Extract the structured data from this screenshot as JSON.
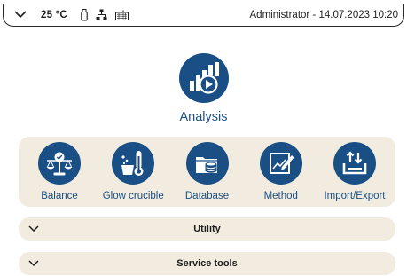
{
  "status_bar": {
    "temperature": "25 °C",
    "user_datetime": "Administrator - 14.07.2023 10:20",
    "icons": [
      "chevron-down-icon",
      "usb-icon",
      "network-icon",
      "keyboard-icon"
    ]
  },
  "hero": {
    "label": "Analysis",
    "icon": "analysis-chart-play-icon"
  },
  "tiles": [
    {
      "label": "Balance",
      "icon": "balance-scale-icon"
    },
    {
      "label": "Glow crucible",
      "icon": "thermometer-crucible-icon"
    },
    {
      "label": "Database",
      "icon": "database-folder-icon"
    },
    {
      "label": "Method",
      "icon": "method-edit-chart-icon"
    },
    {
      "label": "Import/Export",
      "icon": "import-export-icon"
    }
  ],
  "sections": [
    {
      "label": "Utility",
      "state": "collapsed"
    },
    {
      "label": "Service tools",
      "state": "collapsed"
    }
  ],
  "colors": {
    "accent": "#1a4f85",
    "panel": "#f1ecdf",
    "text": "#1f1f1f"
  }
}
